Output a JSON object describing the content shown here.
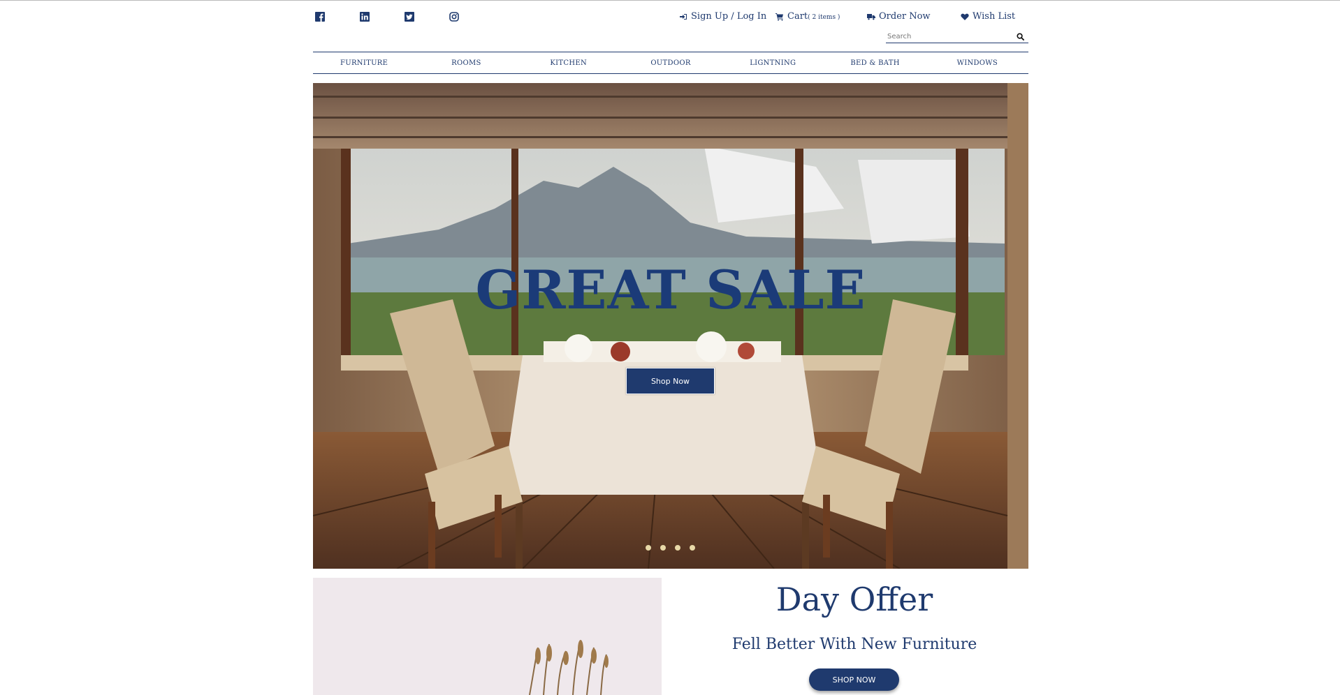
{
  "social": {
    "icons": [
      "facebook-icon",
      "linkedin-icon",
      "twitter-icon",
      "instagram-icon"
    ]
  },
  "header": {
    "signup_label": "Sign Up / Log In",
    "cart_label": "Cart",
    "cart_count": "( 2 items )",
    "order_label": "Order Now",
    "wishlist_label": "Wish List"
  },
  "search": {
    "placeholder": "Search"
  },
  "nav": {
    "items": [
      "FURNITURE",
      "ROOMS",
      "KITCHEN",
      "OUTDOOR",
      "LIGNTNING",
      "BED & BATH",
      "WINDOWS"
    ]
  },
  "hero": {
    "title": "GREAT SALE",
    "button_label": "Shop Now",
    "slides": 4
  },
  "offer": {
    "title": "Day Offer",
    "subtitle": "Fell Better With New Furniture",
    "button_label": "SHOP NOW"
  },
  "colors": {
    "brand": "#1f3a6e",
    "dot": "#e8d9a8",
    "background": "#ffffff"
  }
}
